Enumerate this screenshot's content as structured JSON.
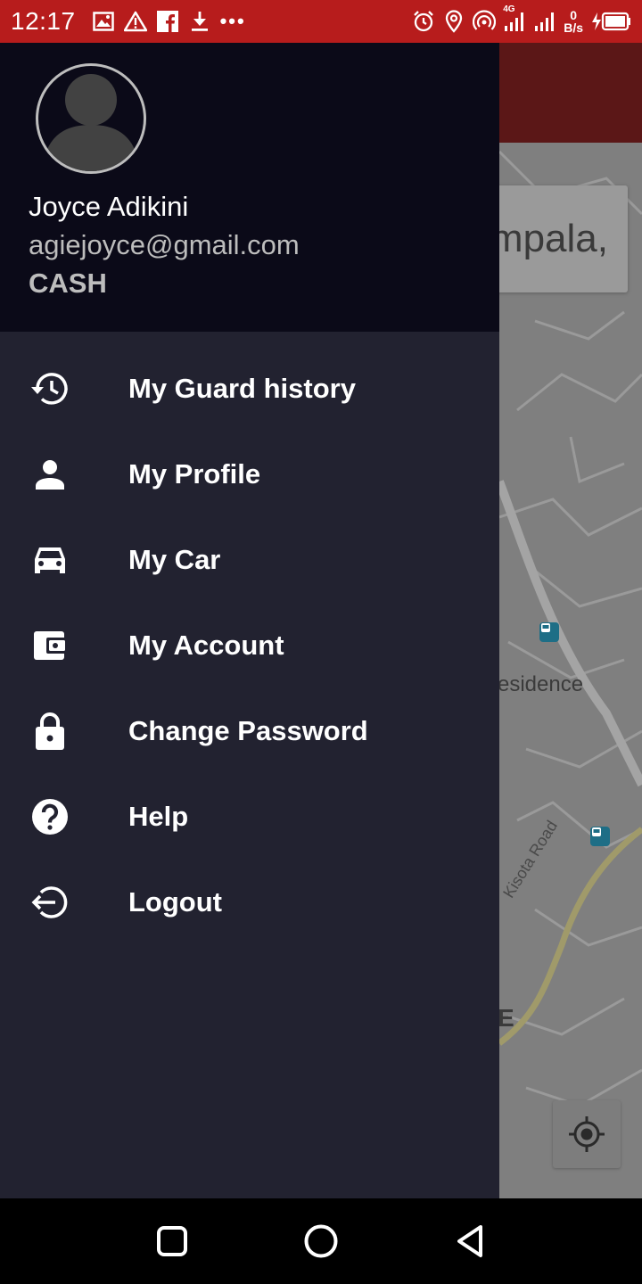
{
  "status_bar": {
    "time": "12:17",
    "net_speed_value": "0",
    "net_speed_unit": "B/s",
    "network_type": "4G",
    "icons_left": [
      "gallery-icon",
      "warning-icon",
      "facebook-icon",
      "download-icon",
      "more-dots-icon"
    ],
    "icons_right": [
      "alarm-icon",
      "location-icon",
      "hotspot-icon",
      "signal-4g-icon",
      "signal-icon",
      "battery-charging-icon"
    ],
    "color": "#b71c1c"
  },
  "background_app": {
    "search_text": "mpala,",
    "map_labels": {
      "residence": "esidence",
      "road": "Kisota Road",
      "partial": "E"
    }
  },
  "drawer": {
    "user": {
      "name": "Joyce Adikini",
      "email": "agiejoyce@gmail.com",
      "payment_method": "CASH"
    },
    "menu": [
      {
        "label": "My Guard history",
        "icon": "history-icon"
      },
      {
        "label": "My Profile",
        "icon": "person-icon"
      },
      {
        "label": "My Car",
        "icon": "car-icon"
      },
      {
        "label": "My Account",
        "icon": "wallet-icon"
      },
      {
        "label": "Change Password",
        "icon": "lock-icon"
      },
      {
        "label": "Help",
        "icon": "help-icon"
      },
      {
        "label": "Logout",
        "icon": "logout-icon"
      }
    ],
    "header_color": "#0b0a18",
    "body_color": "#222230"
  },
  "nav_bar": {
    "buttons": [
      "recents-button",
      "home-button",
      "back-button"
    ]
  }
}
